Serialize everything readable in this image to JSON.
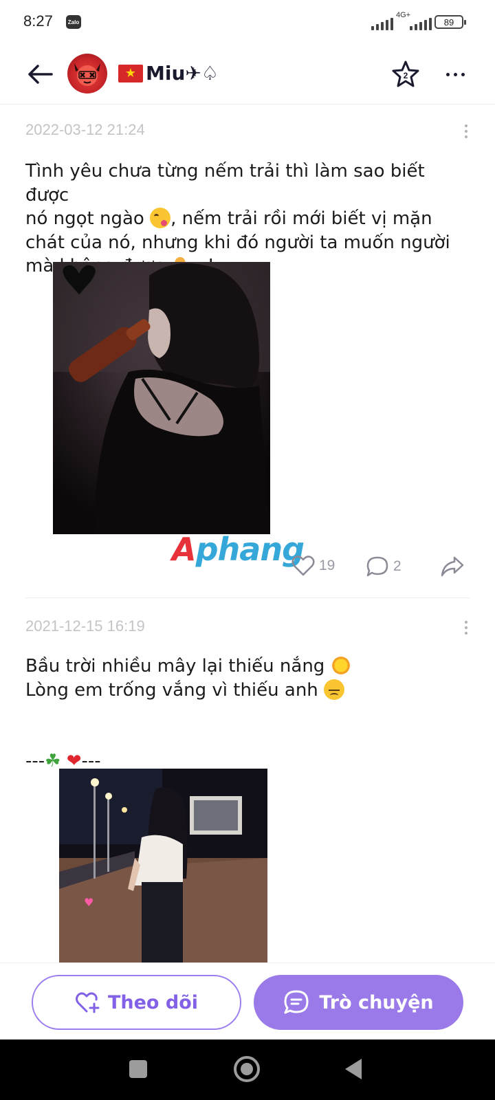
{
  "status_bar": {
    "time": "8:27",
    "app_badge": "Zalo",
    "network": "4G+",
    "battery": "89"
  },
  "header": {
    "name": "Miu✈♤",
    "star_count": "2"
  },
  "posts": [
    {
      "timestamp": "2022-03-12 21:24",
      "text_line1": "Tình yêu chưa từng nếm trải thì làm sao biết được",
      "text_line2a": "nó ngọt ngào ",
      "text_line2b": ", nếm trải rồi mới biết vị mặn",
      "text_line3": "chát của nó, nhưng khi đó người ta muốn người",
      "text_line4a": "mà không được ",
      "text_line4b": "...!",
      "likes": "19",
      "comments": "2"
    },
    {
      "timestamp": "2021-12-15 16:19",
      "text_line1": "Bầu trời nhiều mây lại thiếu nắng ",
      "text_line2": "Lòng em trống vắng vì thiếu anh ",
      "text_line3a": "---",
      "text_line3b": "---"
    }
  ],
  "watermark": {
    "part1": "A",
    "part2": "phang"
  },
  "bottom": {
    "follow_label": "Theo dõi",
    "chat_label": "Trò chuyện"
  },
  "colors": {
    "accent": "#9a7ae8",
    "accent_text": "#8261e6",
    "timestamp": "#c4c4c8"
  }
}
